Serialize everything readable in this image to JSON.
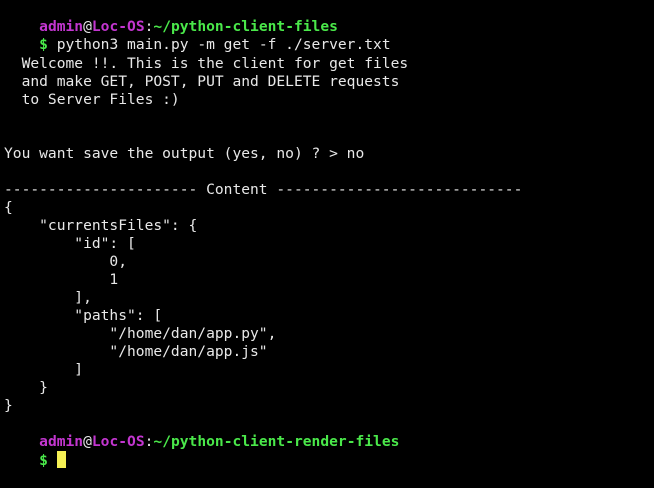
{
  "prompt1": {
    "user": "admin",
    "at": "@",
    "host": "Loc-OS",
    "colon": ":",
    "path": "~/python-client-files",
    "symbol": "$",
    "command": " python3 main.py -m get -f ./server.txt"
  },
  "output": {
    "welcome_lines": [
      "  Welcome !!. This is the client for get files",
      "  and make GET, POST, PUT and DELETE requests",
      "  to Server Files :)"
    ],
    "question": "You want save the output (yes, no) ? > no",
    "separator": "---------------------- Content ----------------------------",
    "json_lines": [
      "{",
      "    \"currentsFiles\": {",
      "        \"id\": [",
      "            0,",
      "            1",
      "        ],",
      "        \"paths\": [",
      "            \"/home/dan/app.py\",",
      "            \"/home/dan/app.js\"",
      "        ]",
      "    }",
      "}"
    ]
  },
  "prompt2": {
    "user": "admin",
    "at": "@",
    "host": "Loc-OS",
    "colon": ":",
    "path": "~/python-client-render-files",
    "symbol": "$"
  },
  "colors": {
    "background": "#000000",
    "text": "#e8e8e8",
    "user_host": "#c336d0",
    "path": "#4ae84a",
    "cursor": "#f5f054"
  }
}
